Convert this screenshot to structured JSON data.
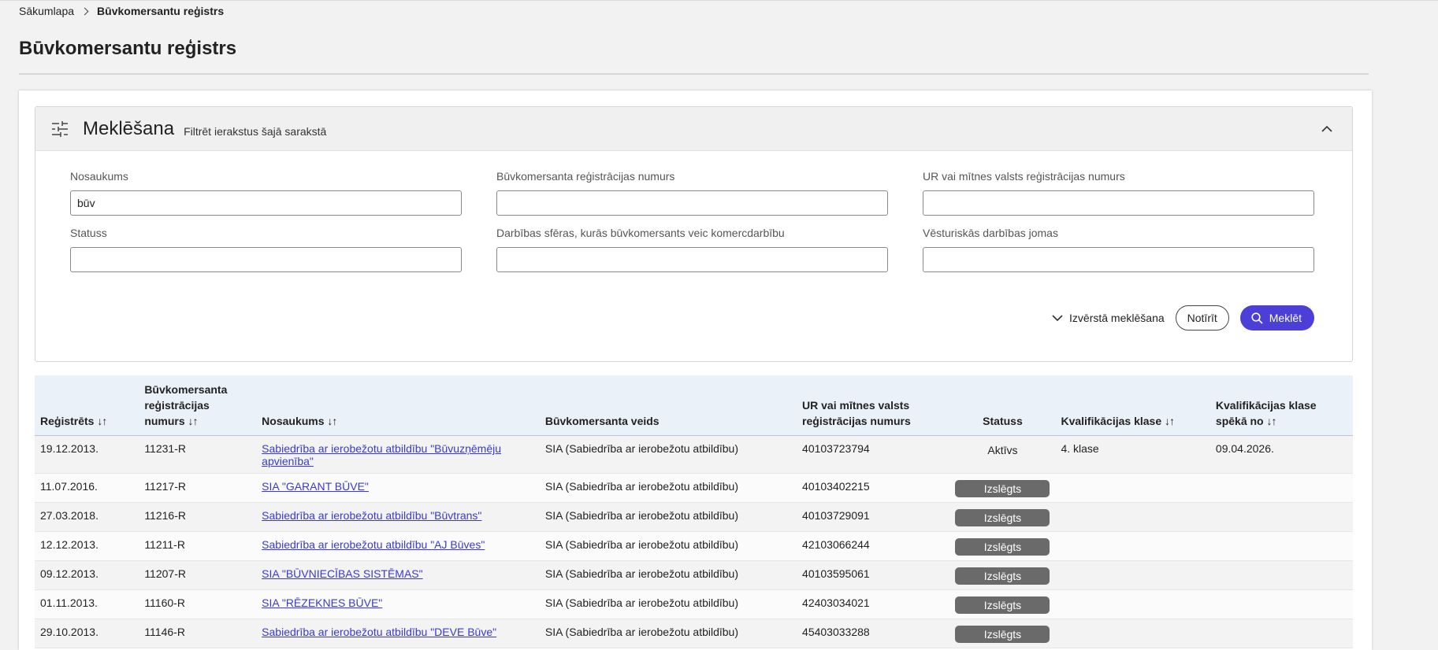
{
  "breadcrumb": {
    "home": "Sākumlapa",
    "current": "Būvkomersantu reģistrs"
  },
  "page": {
    "title": "Būvkomersantu reģistrs"
  },
  "search": {
    "title": "Meklēšana",
    "subtitle": "Filtrēt ierakstus šajā sarakstā",
    "fields": {
      "name": {
        "label": "Nosaukums",
        "value": "būv"
      },
      "reg_number": {
        "label": "Būvkomersanta reģistrācijas numurs",
        "value": ""
      },
      "ur_number": {
        "label": "UR vai mītnes valsts reģistrācijas numurs",
        "value": ""
      },
      "status": {
        "label": "Statuss",
        "value": ""
      },
      "spheres": {
        "label": "Darbības sfēras, kurās būvkomersants veic komercdarbību",
        "value": ""
      },
      "historic": {
        "label": "Vēsturiskās darbības jomas",
        "value": ""
      }
    },
    "advanced_label": "Izvērstā meklēšana",
    "clear_label": "Notīrīt",
    "search_label": "Meklēt"
  },
  "table": {
    "sort_glyph": "↓↑",
    "headers": {
      "registered": "Reģistrēts",
      "reg_number_line1": "Būvkomersanta",
      "reg_number_line2": "reģistrācijas",
      "reg_number_line3": "numurs",
      "name": "Nosaukums",
      "type": "Būvkomersanta veids",
      "ur_line1": "UR vai mītnes valsts",
      "ur_line2": "reģistrācijas numurs",
      "status": "Statuss",
      "qual_class": "Kvalifikācijas klase",
      "qual_valid_line1": "Kvalifikācijas klase",
      "qual_valid_line2": "spēkā no"
    },
    "rows": [
      {
        "registered": "19.12.2013.",
        "reg_number": "11231-R",
        "name": "Sabiedrība ar ierobežotu atbildību \"Būvuzņēmēju apvienība\"",
        "type": "SIA (Sabiedrība ar ierobežotu atbildību)",
        "ur_number": "40103723794",
        "status": "Aktīvs",
        "qual_class": "4. klase",
        "qual_valid": "09.04.2026."
      },
      {
        "registered": "11.07.2016.",
        "reg_number": "11217-R",
        "name": "SIA \"GARANT BŪVE\"",
        "type": "SIA (Sabiedrība ar ierobežotu atbildību)",
        "ur_number": "40103402215",
        "status": "Izslēgts",
        "qual_class": "",
        "qual_valid": ""
      },
      {
        "registered": "27.03.2018.",
        "reg_number": "11216-R",
        "name": "Sabiedrība ar ierobežotu atbildību \"Būvtrans\"",
        "type": "SIA (Sabiedrība ar ierobežotu atbildību)",
        "ur_number": "40103729091",
        "status": "Izslēgts",
        "qual_class": "",
        "qual_valid": ""
      },
      {
        "registered": "12.12.2013.",
        "reg_number": "11211-R",
        "name": "Sabiedrība ar ierobežotu atbildību \"AJ Būves\"",
        "type": "SIA (Sabiedrība ar ierobežotu atbildību)",
        "ur_number": "42103066244",
        "status": "Izslēgts",
        "qual_class": "",
        "qual_valid": ""
      },
      {
        "registered": "09.12.2013.",
        "reg_number": "11207-R",
        "name": "SIA \"BŪVNIECĪBAS SISTĒMAS\"",
        "type": "SIA (Sabiedrība ar ierobežotu atbildību)",
        "ur_number": "40103595061",
        "status": "Izslēgts",
        "qual_class": "",
        "qual_valid": ""
      },
      {
        "registered": "01.11.2013.",
        "reg_number": "11160-R",
        "name": "SIA \"RĒZEKNES BŪVE\"",
        "type": "SIA (Sabiedrība ar ierobežotu atbildību)",
        "ur_number": "42403034021",
        "status": "Izslēgts",
        "qual_class": "",
        "qual_valid": ""
      },
      {
        "registered": "29.10.2013.",
        "reg_number": "11146-R",
        "name": "Sabiedrība ar ierobežotu atbildību \"DEVE Būve\"",
        "type": "SIA (Sabiedrība ar ierobežotu atbildību)",
        "ur_number": "45403033288",
        "status": "Izslēgts",
        "qual_class": "",
        "qual_valid": ""
      }
    ]
  },
  "colors": {
    "accent": "#4b3fd8",
    "link": "#3a3ad0",
    "status_pill": "#6a6a6a",
    "table_header_bg": "#ebf1f9"
  }
}
